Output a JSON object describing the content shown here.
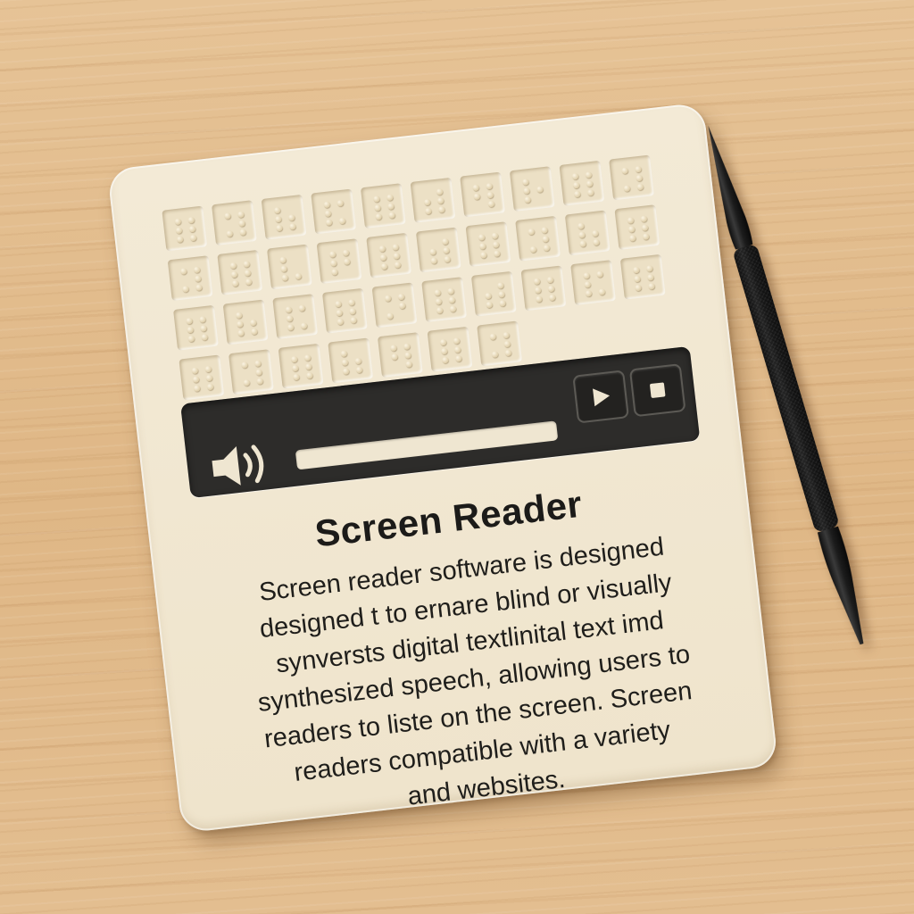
{
  "screen": {
    "title": "Screen Reader",
    "description_lines": [
      "Screen reader software is designed",
      "designed t to ernare blind or visually",
      "synversts digital textlinital text imd",
      "synthesized speech, allowing users to",
      "readers to liste on the screen. Screen",
      "readers compatible with a variety",
      "and websites."
    ]
  },
  "braille_display": {
    "rows": 4,
    "columns": 10,
    "cell_patterns": [
      [
        1,
        1,
        1,
        1,
        1,
        1
      ],
      [
        1,
        1,
        0,
        1,
        1,
        1
      ],
      [
        1,
        0,
        1,
        1,
        1,
        1
      ],
      [
        1,
        1,
        1,
        0,
        1,
        1
      ],
      [
        1,
        1,
        1,
        1,
        1,
        1
      ],
      [
        0,
        1,
        1,
        1,
        1,
        1
      ],
      [
        1,
        1,
        1,
        1,
        0,
        1
      ],
      [
        1,
        0,
        1,
        1,
        1,
        0
      ],
      [
        1,
        1,
        1,
        1,
        1,
        1
      ],
      [
        1,
        1,
        0,
        1,
        1,
        1
      ],
      [
        1,
        1,
        0,
        1,
        1,
        1
      ],
      [
        1,
        1,
        1,
        1,
        1,
        1
      ],
      [
        1,
        0,
        1,
        0,
        1,
        1
      ],
      [
        1,
        1,
        1,
        1,
        1,
        0
      ],
      [
        1,
        1,
        1,
        1,
        1,
        1
      ],
      [
        0,
        1,
        1,
        1,
        1,
        1
      ],
      [
        1,
        1,
        1,
        1,
        1,
        1
      ],
      [
        1,
        1,
        0,
        1,
        1,
        1
      ],
      [
        1,
        0,
        1,
        1,
        1,
        1
      ],
      [
        1,
        1,
        1,
        1,
        1,
        1
      ],
      [
        1,
        1,
        1,
        1,
        1,
        1
      ],
      [
        1,
        0,
        1,
        1,
        1,
        1
      ],
      [
        1,
        1,
        1,
        0,
        1,
        1
      ],
      [
        1,
        1,
        1,
        1,
        1,
        1
      ],
      [
        1,
        1,
        0,
        1,
        1,
        0
      ],
      [
        1,
        1,
        1,
        1,
        1,
        1
      ],
      [
        0,
        1,
        1,
        1,
        1,
        1
      ],
      [
        1,
        1,
        1,
        1,
        1,
        1
      ],
      [
        1,
        1,
        1,
        0,
        1,
        1
      ],
      [
        1,
        1,
        1,
        1,
        1,
        1
      ],
      [
        1,
        1,
        1,
        1,
        1,
        1
      ],
      [
        1,
        1,
        0,
        1,
        1,
        1
      ],
      [
        1,
        1,
        1,
        1,
        1,
        1
      ],
      [
        1,
        0,
        1,
        1,
        1,
        1
      ],
      [
        1,
        1,
        1,
        1,
        0,
        1
      ],
      [
        1,
        1,
        1,
        1,
        1,
        1
      ],
      [
        1,
        1,
        0,
        1,
        1,
        1
      ],
      [
        0,
        0,
        0,
        0,
        0,
        0
      ],
      [
        0,
        0,
        0,
        0,
        0,
        0
      ],
      [
        0,
        0,
        0,
        0,
        0,
        0
      ]
    ]
  },
  "media_controls": {
    "icons": {
      "speaker": "speaker-icon",
      "play": "play-icon",
      "stop": "stop-icon"
    },
    "progress": 0
  },
  "colors": {
    "device": "#f0e6cf",
    "control_panel": "#2d2c2a",
    "text": "#1c1b19",
    "stylus": "#1e1e1e"
  }
}
